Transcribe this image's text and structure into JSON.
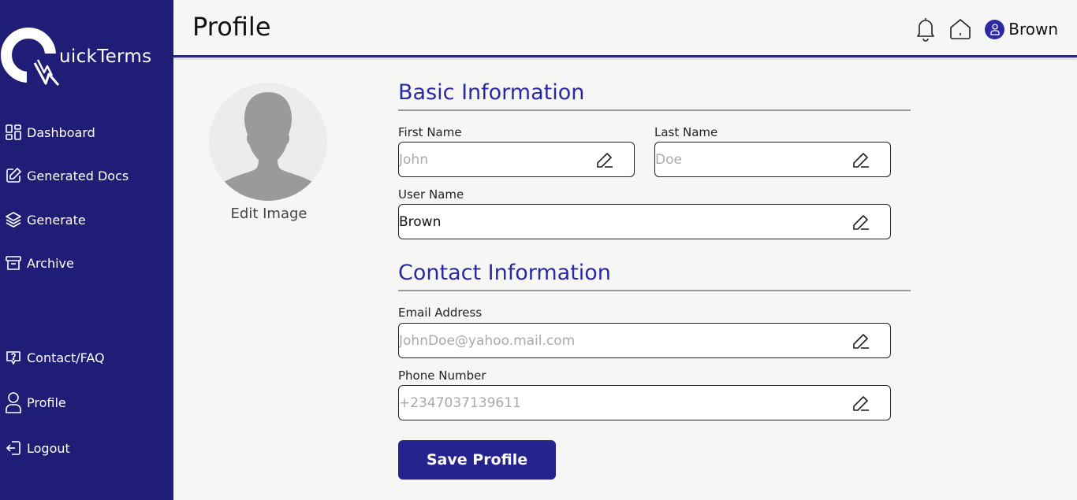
{
  "app": {
    "logo_text": "uickTerms",
    "logo_icon": "quickterms-logo-icon"
  },
  "sidebar": {
    "items": [
      {
        "label": "Dashboard",
        "icon": "dashboard-grid-icon"
      },
      {
        "label": "Generated Docs",
        "icon": "edit-doc-icon"
      },
      {
        "label": "Generate",
        "icon": "layers-icon"
      },
      {
        "label": "Archive",
        "icon": "archive-box-icon"
      },
      {
        "label": "Contact/FAQ",
        "icon": "help-chat-icon"
      },
      {
        "label": "Profile",
        "icon": "user-icon"
      },
      {
        "label": "Logout",
        "icon": "logout-icon"
      }
    ]
  },
  "header": {
    "title": "Profile",
    "user_name": "Brown",
    "icons": [
      "bell-icon",
      "home-icon",
      "user-avatar-icon"
    ]
  },
  "profile": {
    "edit_image_label": "Edit Image"
  },
  "basic_info": {
    "title": "Basic Information",
    "first_name_label": "First Name",
    "first_name_placeholder": "John",
    "last_name_label": "Last Name",
    "last_name_placeholder": "Doe",
    "user_name_label": "User Name",
    "user_name_value": "Brown"
  },
  "contact_info": {
    "title": "Contact Information",
    "email_label": "Email Address",
    "email_placeholder": "JohnDoe@yahoo.mail.com",
    "phone_label": "Phone Number",
    "phone_placeholder": "+2347037139611"
  },
  "actions": {
    "save_label": "Save Profile"
  },
  "colors": {
    "sidebar_bg": "#1f1d76",
    "accent": "#2b28a8",
    "button_bg": "#26238f",
    "page_bg": "#f6f7f5"
  }
}
